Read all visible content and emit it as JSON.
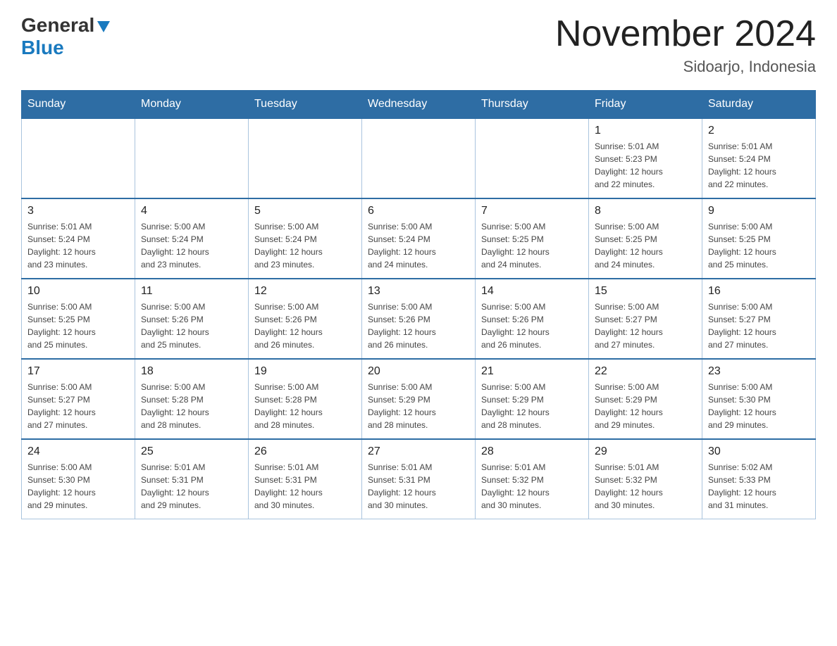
{
  "header": {
    "logo_general": "General",
    "logo_blue": "Blue",
    "month_title": "November 2024",
    "location": "Sidoarjo, Indonesia"
  },
  "days_of_week": [
    "Sunday",
    "Monday",
    "Tuesday",
    "Wednesday",
    "Thursday",
    "Friday",
    "Saturday"
  ],
  "weeks": [
    {
      "days": [
        {
          "number": "",
          "info": "",
          "empty": true
        },
        {
          "number": "",
          "info": "",
          "empty": true
        },
        {
          "number": "",
          "info": "",
          "empty": true
        },
        {
          "number": "",
          "info": "",
          "empty": true
        },
        {
          "number": "",
          "info": "",
          "empty": true
        },
        {
          "number": "1",
          "info": "Sunrise: 5:01 AM\nSunset: 5:23 PM\nDaylight: 12 hours\nand 22 minutes."
        },
        {
          "number": "2",
          "info": "Sunrise: 5:01 AM\nSunset: 5:24 PM\nDaylight: 12 hours\nand 22 minutes."
        }
      ]
    },
    {
      "days": [
        {
          "number": "3",
          "info": "Sunrise: 5:01 AM\nSunset: 5:24 PM\nDaylight: 12 hours\nand 23 minutes."
        },
        {
          "number": "4",
          "info": "Sunrise: 5:00 AM\nSunset: 5:24 PM\nDaylight: 12 hours\nand 23 minutes."
        },
        {
          "number": "5",
          "info": "Sunrise: 5:00 AM\nSunset: 5:24 PM\nDaylight: 12 hours\nand 23 minutes."
        },
        {
          "number": "6",
          "info": "Sunrise: 5:00 AM\nSunset: 5:24 PM\nDaylight: 12 hours\nand 24 minutes."
        },
        {
          "number": "7",
          "info": "Sunrise: 5:00 AM\nSunset: 5:25 PM\nDaylight: 12 hours\nand 24 minutes."
        },
        {
          "number": "8",
          "info": "Sunrise: 5:00 AM\nSunset: 5:25 PM\nDaylight: 12 hours\nand 24 minutes."
        },
        {
          "number": "9",
          "info": "Sunrise: 5:00 AM\nSunset: 5:25 PM\nDaylight: 12 hours\nand 25 minutes."
        }
      ]
    },
    {
      "days": [
        {
          "number": "10",
          "info": "Sunrise: 5:00 AM\nSunset: 5:25 PM\nDaylight: 12 hours\nand 25 minutes."
        },
        {
          "number": "11",
          "info": "Sunrise: 5:00 AM\nSunset: 5:26 PM\nDaylight: 12 hours\nand 25 minutes."
        },
        {
          "number": "12",
          "info": "Sunrise: 5:00 AM\nSunset: 5:26 PM\nDaylight: 12 hours\nand 26 minutes."
        },
        {
          "number": "13",
          "info": "Sunrise: 5:00 AM\nSunset: 5:26 PM\nDaylight: 12 hours\nand 26 minutes."
        },
        {
          "number": "14",
          "info": "Sunrise: 5:00 AM\nSunset: 5:26 PM\nDaylight: 12 hours\nand 26 minutes."
        },
        {
          "number": "15",
          "info": "Sunrise: 5:00 AM\nSunset: 5:27 PM\nDaylight: 12 hours\nand 27 minutes."
        },
        {
          "number": "16",
          "info": "Sunrise: 5:00 AM\nSunset: 5:27 PM\nDaylight: 12 hours\nand 27 minutes."
        }
      ]
    },
    {
      "days": [
        {
          "number": "17",
          "info": "Sunrise: 5:00 AM\nSunset: 5:27 PM\nDaylight: 12 hours\nand 27 minutes."
        },
        {
          "number": "18",
          "info": "Sunrise: 5:00 AM\nSunset: 5:28 PM\nDaylight: 12 hours\nand 28 minutes."
        },
        {
          "number": "19",
          "info": "Sunrise: 5:00 AM\nSunset: 5:28 PM\nDaylight: 12 hours\nand 28 minutes."
        },
        {
          "number": "20",
          "info": "Sunrise: 5:00 AM\nSunset: 5:29 PM\nDaylight: 12 hours\nand 28 minutes."
        },
        {
          "number": "21",
          "info": "Sunrise: 5:00 AM\nSunset: 5:29 PM\nDaylight: 12 hours\nand 28 minutes."
        },
        {
          "number": "22",
          "info": "Sunrise: 5:00 AM\nSunset: 5:29 PM\nDaylight: 12 hours\nand 29 minutes."
        },
        {
          "number": "23",
          "info": "Sunrise: 5:00 AM\nSunset: 5:30 PM\nDaylight: 12 hours\nand 29 minutes."
        }
      ]
    },
    {
      "days": [
        {
          "number": "24",
          "info": "Sunrise: 5:00 AM\nSunset: 5:30 PM\nDaylight: 12 hours\nand 29 minutes."
        },
        {
          "number": "25",
          "info": "Sunrise: 5:01 AM\nSunset: 5:31 PM\nDaylight: 12 hours\nand 29 minutes."
        },
        {
          "number": "26",
          "info": "Sunrise: 5:01 AM\nSunset: 5:31 PM\nDaylight: 12 hours\nand 30 minutes."
        },
        {
          "number": "27",
          "info": "Sunrise: 5:01 AM\nSunset: 5:31 PM\nDaylight: 12 hours\nand 30 minutes."
        },
        {
          "number": "28",
          "info": "Sunrise: 5:01 AM\nSunset: 5:32 PM\nDaylight: 12 hours\nand 30 minutes."
        },
        {
          "number": "29",
          "info": "Sunrise: 5:01 AM\nSunset: 5:32 PM\nDaylight: 12 hours\nand 30 minutes."
        },
        {
          "number": "30",
          "info": "Sunrise: 5:02 AM\nSunset: 5:33 PM\nDaylight: 12 hours\nand 31 minutes."
        }
      ]
    }
  ]
}
